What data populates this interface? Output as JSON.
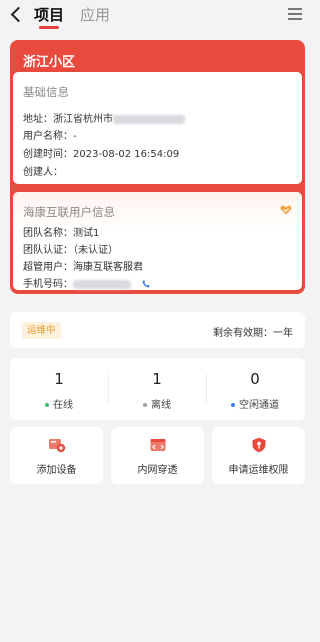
{
  "nav": {
    "tab_project": "项目",
    "tab_app": "应用"
  },
  "project": {
    "name": "浙江小区",
    "basic": {
      "title": "基础信息",
      "address_label": "地址：",
      "address_value": "浙江省杭州市",
      "user_label": "用户名称：",
      "user_value": "-",
      "created_label": "创建时间：",
      "created_value": "2023-08-02 16:54:09",
      "creator_label": "创建人：",
      "creator_value": ""
    },
    "hik": {
      "title": "海康互联用户信息",
      "team_label": "团队名称：",
      "team_value": "测试1",
      "cert_label": "团队认证：",
      "cert_value": "（未认证）",
      "admin_label": "超管用户：",
      "admin_value": "海康互联客服君",
      "phone_label": "手机号码："
    }
  },
  "status": {
    "badge": "运维中",
    "validity": "剩余有效期：一年"
  },
  "stats": [
    {
      "value": "1",
      "label": "在线",
      "dot_color": "#3cbf6a"
    },
    {
      "value": "1",
      "label": "离线",
      "dot_color": "#9aa0a6"
    },
    {
      "value": "0",
      "label": "空闲通道",
      "dot_color": "#3b7ff0"
    }
  ],
  "actions": [
    {
      "label": "添加设备",
      "icon": "add-device-icon"
    },
    {
      "label": "内网穿透",
      "icon": "intranet-icon"
    },
    {
      "label": "申请运维权限",
      "icon": "shield-icon"
    }
  ],
  "colors": {
    "accent": "#e84a3e",
    "badge_bg": "#fdf0dd",
    "badge_text": "#e59a2d"
  }
}
